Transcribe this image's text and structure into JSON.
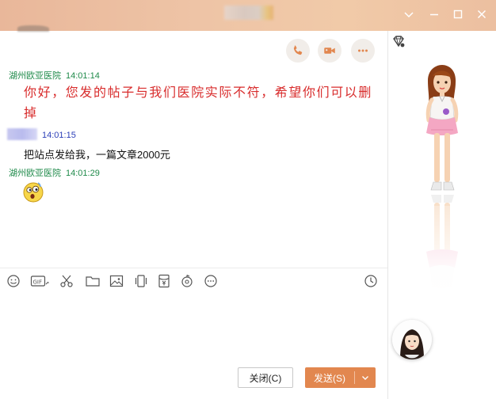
{
  "window": {
    "title_blurred": "",
    "controls": {
      "minimize": "chevron-down",
      "restore": "minimize",
      "maximize": "square",
      "close": "close"
    }
  },
  "call_buttons": [
    "phone-icon",
    "video-icon",
    "more-icon"
  ],
  "messages": [
    {
      "sender": "湖州欧亚医院",
      "time": "14:01:14",
      "text": "你好，您发的帖子与我们医院实际不符，希望你们可以删掉",
      "color": "#d82c2c"
    },
    {
      "sender": "",
      "time": "14:01:15",
      "text": "把站点发给我，一篇文章2000元",
      "color": "#111111"
    },
    {
      "sender": "湖州欧亚医院",
      "time": "14:01:29",
      "text": "",
      "emoji": "surprised-face"
    }
  ],
  "toolbar": [
    "emoji-icon",
    "gif-icon",
    "scissors-icon",
    "folder-icon",
    "image-icon",
    "shake-icon",
    "red-packet-icon",
    "music-icon",
    "more-icon",
    "history-clock-icon"
  ],
  "buttons": {
    "close": "关闭(C)",
    "send": "发送(S)"
  },
  "colors": {
    "send": "#e2874f",
    "sender_green": "#1f8a4a",
    "time_blue": "#2c3fb8",
    "accent_red": "#d82c2c"
  }
}
